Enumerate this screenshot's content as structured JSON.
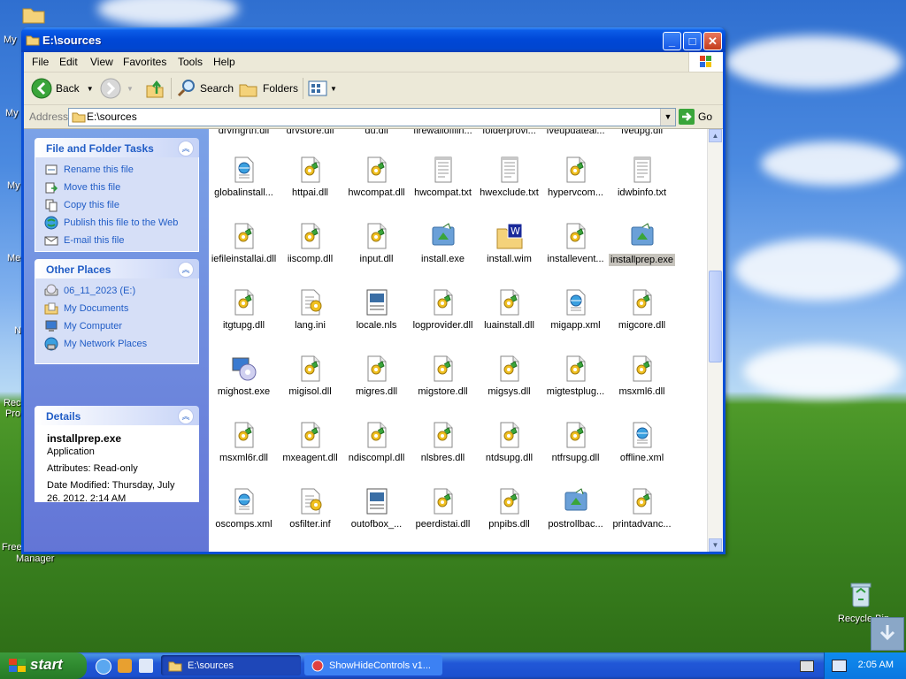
{
  "window": {
    "title": "E:\\sources"
  },
  "menu": [
    "File",
    "Edit",
    "View",
    "Favorites",
    "Tools",
    "Help"
  ],
  "toolbar": {
    "back": "Back",
    "search": "Search",
    "folders": "Folders"
  },
  "address": {
    "label": "Address",
    "value": "E:\\sources",
    "go": "Go"
  },
  "panels": {
    "tasks": {
      "title": "File and Folder Tasks",
      "items": [
        "Rename this file",
        "Move this file",
        "Copy this file",
        "Publish this file to the Web",
        "E-mail this file"
      ]
    },
    "places": {
      "title": "Other Places",
      "items": [
        "06_11_2023 (E:)",
        "My Documents",
        "My Computer",
        "My Network Places"
      ]
    },
    "details": {
      "title": "Details",
      "name": "installprep.exe",
      "type": "Application",
      "attributes": "Attributes: Read-only",
      "modified": "Date Modified: Thursday, July 26, 2012, 2:14 AM"
    }
  },
  "top_row": [
    "drvmgrtn.dll",
    "drvstore.dll",
    "du.dll",
    "firewallofflin...",
    "folderprovi...",
    "fveupdateal...",
    "fveupg.dll"
  ],
  "files": [
    {
      "name": "globalinstall...",
      "kind": "xml"
    },
    {
      "name": "httpai.dll",
      "kind": "dll"
    },
    {
      "name": "hwcompat.dll",
      "kind": "dll"
    },
    {
      "name": "hwcompat.txt",
      "kind": "txt"
    },
    {
      "name": "hwexclude.txt",
      "kind": "txt"
    },
    {
      "name": "hypervcom...",
      "kind": "dll"
    },
    {
      "name": "idwbinfo.txt",
      "kind": "txt"
    },
    {
      "name": "iefileinstallai.dll",
      "kind": "dll"
    },
    {
      "name": "iiscomp.dll",
      "kind": "dll"
    },
    {
      "name": "input.dll",
      "kind": "dll"
    },
    {
      "name": "install.exe",
      "kind": "exe"
    },
    {
      "name": "install.wim",
      "kind": "wim"
    },
    {
      "name": "installevent...",
      "kind": "dll"
    },
    {
      "name": "installprep.exe",
      "kind": "exe",
      "selected": true
    },
    {
      "name": "itgtupg.dll",
      "kind": "dll"
    },
    {
      "name": "lang.ini",
      "kind": "ini"
    },
    {
      "name": "locale.nls",
      "kind": "nls"
    },
    {
      "name": "logprovider.dll",
      "kind": "dll"
    },
    {
      "name": "luainstall.dll",
      "kind": "dll"
    },
    {
      "name": "migapp.xml",
      "kind": "xml"
    },
    {
      "name": "migcore.dll",
      "kind": "dll"
    },
    {
      "name": "mighost.exe",
      "kind": "mighost"
    },
    {
      "name": "migisol.dll",
      "kind": "dll"
    },
    {
      "name": "migres.dll",
      "kind": "dll"
    },
    {
      "name": "migstore.dll",
      "kind": "dll"
    },
    {
      "name": "migsys.dll",
      "kind": "dll"
    },
    {
      "name": "migtestplug...",
      "kind": "dll"
    },
    {
      "name": "msxml6.dll",
      "kind": "dll"
    },
    {
      "name": "msxml6r.dll",
      "kind": "dll"
    },
    {
      "name": "mxeagent.dll",
      "kind": "dll"
    },
    {
      "name": "ndiscompl.dll",
      "kind": "dll"
    },
    {
      "name": "nlsbres.dll",
      "kind": "dll"
    },
    {
      "name": "ntdsupg.dll",
      "kind": "dll"
    },
    {
      "name": "ntfrsupg.dll",
      "kind": "dll"
    },
    {
      "name": "offline.xml",
      "kind": "xml"
    },
    {
      "name": "oscomps.xml",
      "kind": "xml"
    },
    {
      "name": "osfilter.inf",
      "kind": "ini"
    },
    {
      "name": "outofbox_...",
      "kind": "nls"
    },
    {
      "name": "peerdistai.dll",
      "kind": "dll"
    },
    {
      "name": "pnpibs.dll",
      "kind": "dll"
    },
    {
      "name": "postrollbac...",
      "kind": "exe"
    },
    {
      "name": "printadvanc...",
      "kind": "dll"
    }
  ],
  "desktop": {
    "labels": [
      "My",
      "My",
      "My",
      "Me",
      "N",
      "Rec",
      "Pro",
      "Free",
      "Manager"
    ],
    "recycle": "Recycle Bin"
  },
  "taskbar": {
    "start": "start",
    "task1": "E:\\sources",
    "task2": "ShowHideControls v1...",
    "clock": "2:05 AM"
  }
}
